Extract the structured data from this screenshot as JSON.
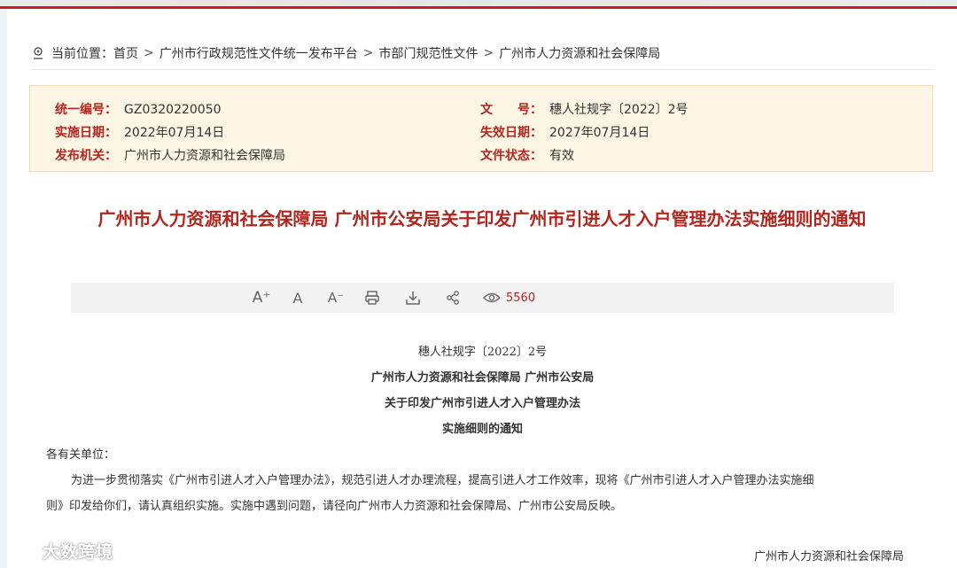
{
  "breadcrumb": {
    "prefix": "当前位置：",
    "items": [
      "首页",
      "广州市行政规范性文件统一发布平台",
      "市部门规范性文件",
      "广州市人力资源和社会保障局"
    ],
    "separator": ">"
  },
  "info": {
    "code_label": "统一编号：",
    "code_value": "GZ0320220050",
    "docno_label": "文　　号：",
    "docno_value": "穗人社规字〔2022〕2号",
    "effective_label": "实施日期：",
    "effective_value": "2022年07月14日",
    "expire_label": "失效日期：",
    "expire_value": "2027年07月14日",
    "issuer_label": "发布机关：",
    "issuer_value": "广州市人力资源和社会保障局",
    "status_label": "文件状态：",
    "status_value": "有效"
  },
  "title": "广州市人力资源和社会保障局 广州市公安局关于印发广州市引进人才入户管理办法实施细则的通知",
  "toolbar": {
    "font_increase": "A⁺",
    "font_normal": "A",
    "font_decrease": "A⁻",
    "view_count": "5560"
  },
  "content": {
    "doc_number": "穗人社规字〔2022〕2号",
    "issuers": "广州市人力资源和社会保障局 广州市公安局",
    "heading_line1": "关于印发广州市引进人才入户管理办法",
    "heading_line2": "实施细则的通知",
    "salutation": "各有关单位：",
    "para_line1": "为进一步贯彻落实《广州市引进人才入户管理办法》，规范引进人才办理流程，提高引进人才工作效率，现将《广州市引进人才入户管理办法实施细",
    "para_line2": "则》印发给你们，请认真组织实施。实施中遇到问题，请径向广州市人力资源和社会保障局、广州市公安局反映。",
    "signature": "广州市人力资源和社会保障局"
  },
  "watermark": "大数跨境",
  "colors": {
    "accent": "#b3261e",
    "info_bg": "#fdf6e5",
    "toolbar_bg": "#f3f3f3"
  }
}
